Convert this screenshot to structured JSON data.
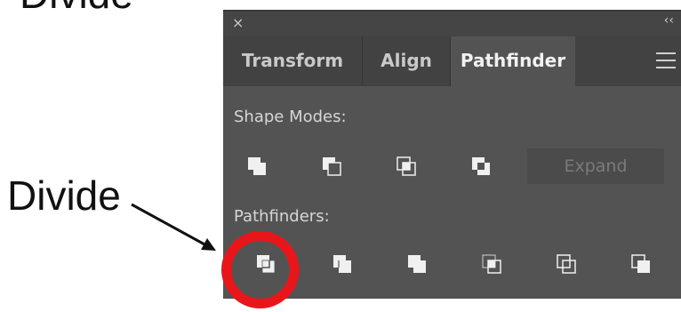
{
  "annotations": {
    "top_caption": "Divide",
    "callout_label": "Divide",
    "highlight_color": "#e8161b"
  },
  "panel": {
    "close_icon": "×",
    "collapse_icon": "‹‹",
    "tabs": [
      {
        "label": "Transform",
        "active": false
      },
      {
        "label": "Align",
        "active": false
      },
      {
        "label": "Pathfinder",
        "active": true
      }
    ],
    "menu_icon": "hamburger-menu-icon",
    "shape_modes_label": "Shape Modes:",
    "shape_mode_buttons": [
      "unite-icon",
      "minus-front-icon",
      "intersect-icon",
      "exclude-icon"
    ],
    "expand_label": "Expand",
    "pathfinders_label": "Pathfinders:",
    "pathfinder_buttons": [
      "divide-icon",
      "trim-icon",
      "merge-icon",
      "crop-icon",
      "outline-icon",
      "minus-back-icon"
    ]
  },
  "colors": {
    "panel_bg": "#535353",
    "tab_bar_bg": "#424242",
    "icon_light": "#f0f0f0"
  }
}
